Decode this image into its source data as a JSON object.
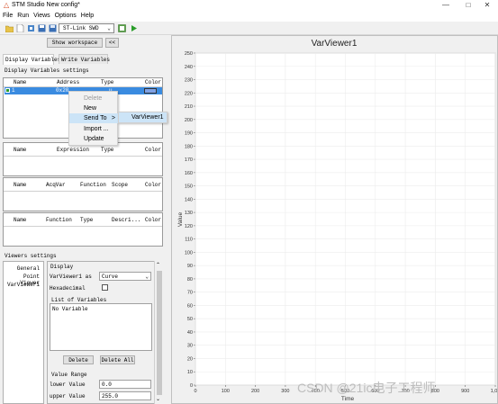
{
  "window": {
    "title": "STM Studio New config*",
    "min_glyph": "—",
    "max_glyph": "□",
    "close_glyph": "✕"
  },
  "menu": [
    "File",
    "Run",
    "Views",
    "Options",
    "Help"
  ],
  "toolbar": {
    "connection": "ST-Link SWD"
  },
  "left": {
    "show_workspace": "Show workspace",
    "collapse": "<<",
    "tabs": [
      "Display Variables",
      "Write Variables"
    ],
    "display_settings_label": "Display Variables settings",
    "grid1": {
      "headers": [
        "Name",
        "Address",
        "Type",
        "Color"
      ],
      "row": {
        "name": "i",
        "address": "0x20",
        "type": "u"
      }
    },
    "grid2": {
      "headers": [
        "Name",
        "Expression",
        "Type",
        "Color"
      ]
    },
    "grid3": {
      "headers": [
        "Name",
        "AcqVar",
        "Function",
        "Scope",
        "Color"
      ]
    },
    "grid4": {
      "headers": [
        "Name",
        "Function",
        "Type",
        "Descri...",
        "Color"
      ]
    },
    "viewers_settings_label": "Viewers settings",
    "viewer_list": [
      "General",
      "Point Viewer",
      "VarViewer1"
    ],
    "display": {
      "group_label": "Display",
      "as_label": "VarViewer1 as",
      "as_value": "Curve",
      "hex_label": "Hexadecimal",
      "list_label": "List of Variables",
      "list_empty": "No Variable",
      "delete": "Delete",
      "delete_all": "Delete All",
      "range_label": "Value Range",
      "lower_label": "lower Value",
      "lower_value": "0.0",
      "upper_label": "upper Value",
      "upper_value": "255.0"
    }
  },
  "context_menu": {
    "items": [
      {
        "label": "Delete",
        "enabled": false
      },
      {
        "label": "New",
        "enabled": true
      },
      {
        "label": "Send To",
        "enabled": true,
        "arrow": ">"
      },
      {
        "label": "Import ...",
        "enabled": true
      },
      {
        "label": "Update",
        "enabled": true
      }
    ],
    "submenu": [
      "VarViewer1"
    ]
  },
  "chart_data": {
    "type": "line",
    "title": "VarViewer1",
    "xlabel": "Time",
    "ylabel": "Value",
    "xlim": [
      0,
      1000
    ],
    "ylim": [
      0,
      250
    ],
    "yticks": [
      0,
      10,
      20,
      30,
      40,
      50,
      60,
      70,
      80,
      90,
      100,
      110,
      120,
      130,
      140,
      150,
      160,
      170,
      180,
      190,
      200,
      210,
      220,
      230,
      240,
      250
    ],
    "xticks": [
      0,
      100,
      200,
      300,
      400,
      500,
      600,
      700,
      800,
      900,
      1000
    ],
    "xtick_labels": [
      "0",
      "100",
      "200",
      "300",
      "400",
      "500",
      "600",
      "700",
      "800",
      "900",
      "1,00"
    ],
    "series": [],
    "grid": true
  },
  "watermark": "CSDN @21ic电子工程师"
}
